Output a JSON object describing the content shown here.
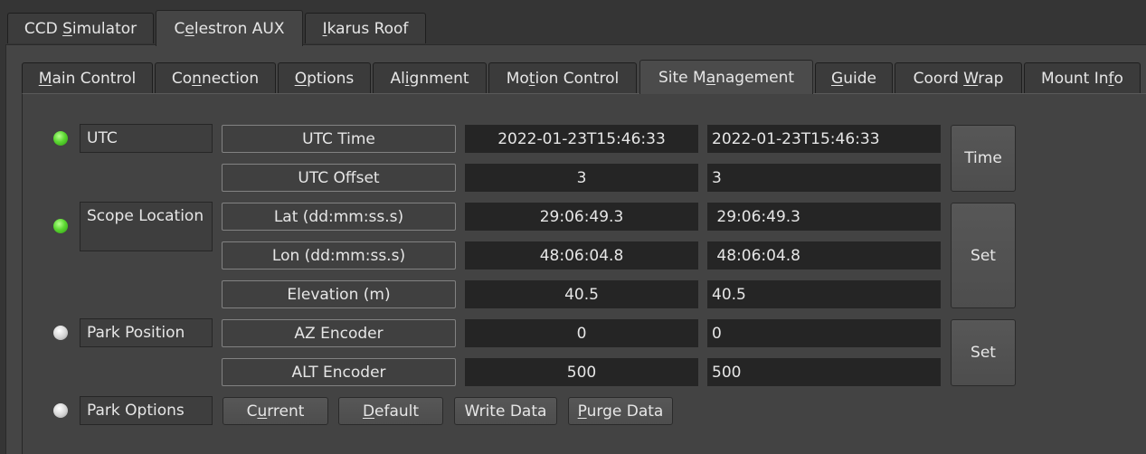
{
  "device_tabs": [
    {
      "pre": "CCD ",
      "key": "S",
      "post": "imulator"
    },
    {
      "pre": "C",
      "key": "e",
      "post": "lestron AUX"
    },
    {
      "pre": "",
      "key": "I",
      "post": "karus Roof"
    }
  ],
  "property_tabs": [
    {
      "pre": "",
      "key": "M",
      "post": "ain Control"
    },
    {
      "pre": "Co",
      "key": "n",
      "post": "nection"
    },
    {
      "pre": "",
      "key": "O",
      "post": "ptions"
    },
    {
      "pre": "Al",
      "key": "i",
      "post": "gnment"
    },
    {
      "pre": "Mo",
      "key": "t",
      "post": "ion Control"
    },
    {
      "pre": "Site M",
      "key": "a",
      "post": "nagement"
    },
    {
      "pre": "",
      "key": "G",
      "post": "uide"
    },
    {
      "pre": "Coord ",
      "key": "W",
      "post": "rap"
    },
    {
      "pre": "Mount In",
      "key": "f",
      "post": "o"
    }
  ],
  "groups": {
    "utc": "UTC",
    "scope_location": "Scope Location",
    "park_position": "Park Position",
    "park_options": "Park Options"
  },
  "status_colors": {
    "ok": "#5cd832",
    "idle": "#d4d4d4"
  },
  "rows": {
    "utc_time": {
      "label": "UTC Time",
      "value": "2022-01-23T15:46:33",
      "input": "2022-01-23T15:46:33"
    },
    "utc_offset": {
      "label": "UTC Offset",
      "value": "3",
      "input": "3"
    },
    "lat": {
      "label": "Lat (dd:mm:ss.s)",
      "value": "29:06:49.3",
      "input": " 29:06:49.3"
    },
    "lon": {
      "label": "Lon (dd:mm:ss.s)",
      "value": "48:06:04.8",
      "input": " 48:06:04.8"
    },
    "elevation": {
      "label": "Elevation (m)",
      "value": "40.5",
      "input": "40.5"
    },
    "az_encoder": {
      "label": "AZ Encoder",
      "value": "0",
      "input": "0"
    },
    "alt_encoder": {
      "label": "ALT Encoder",
      "value": "500",
      "input": "500"
    }
  },
  "side_buttons": {
    "time": "Time",
    "location_set": "Set",
    "park_set": "Set"
  },
  "park_option_buttons": [
    {
      "pre": "C",
      "key": "u",
      "post": "rrent"
    },
    {
      "pre": "",
      "key": "D",
      "post": "efault"
    },
    {
      "pre": "Write Data",
      "key": "",
      "post": ""
    },
    {
      "pre": "",
      "key": "P",
      "post": "urge Data"
    }
  ]
}
